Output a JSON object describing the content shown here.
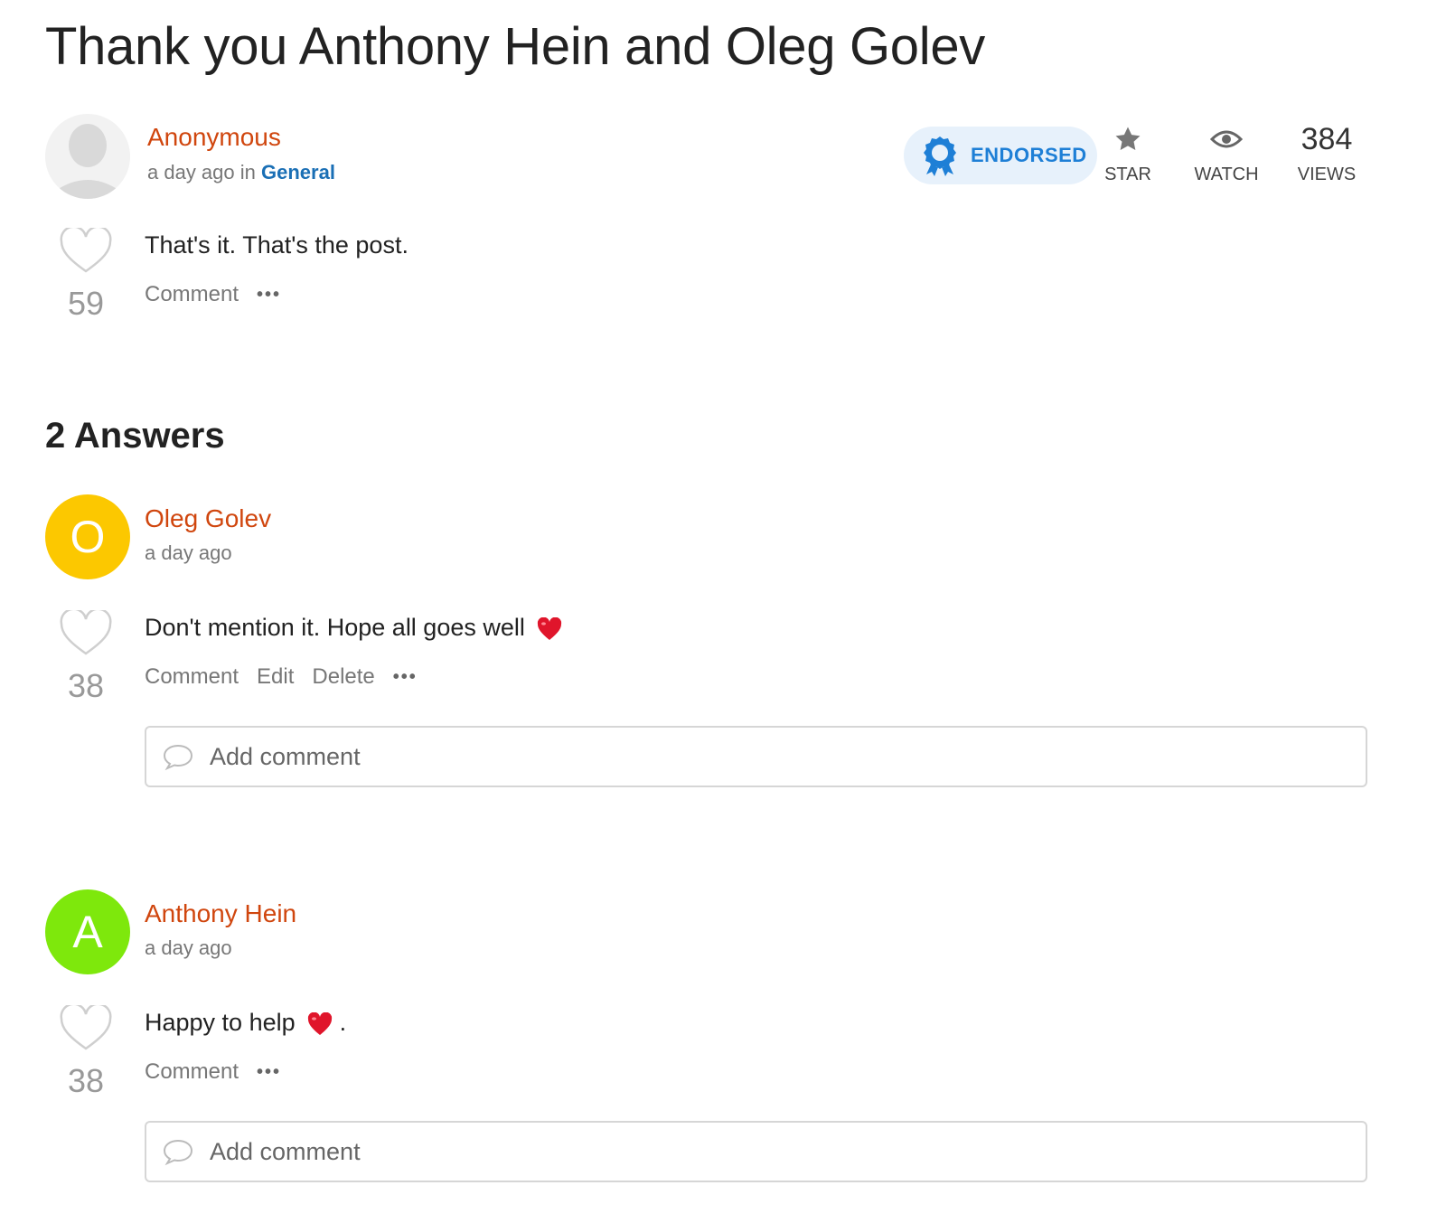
{
  "title": "Thank you Anthony Hein and Oleg Golev",
  "post": {
    "author": "Anonymous",
    "time": "a day ago",
    "in_word": "in",
    "category": "General",
    "endorsed_label": "ENDORSED",
    "star_label": "STAR",
    "watch_label": "WATCH",
    "views_count": "384",
    "views_label": "VIEWS",
    "body": "That's it. That's the post.",
    "likes": "59",
    "comment_label": "Comment",
    "more_label": "•••"
  },
  "answers_heading": "2 Answers",
  "answers": [
    {
      "avatar_letter": "O",
      "avatar_color": "#fcc800",
      "author": "Oleg Golev",
      "time": "a day ago",
      "body": "Don't mention it. Hope all goes well",
      "likes": "38",
      "comment_label": "Comment",
      "edit_label": "Edit",
      "delete_label": "Delete",
      "more_label": "•••",
      "add_comment_placeholder": "Add comment"
    },
    {
      "avatar_letter": "A",
      "avatar_color": "#7ee80c",
      "author": "Anthony Hein",
      "time": "a day ago",
      "body": "Happy to help",
      "body_suffix": ".",
      "likes": "38",
      "comment_label": "Comment",
      "more_label": "•••",
      "add_comment_placeholder": "Add comment"
    }
  ],
  "colors": {
    "author": "#d0460e",
    "category": "#1a6fb5",
    "endorsed_bg": "#e7f1fb",
    "endorsed_fg": "#1e7fd6",
    "heart_emoji": "#e0152b"
  },
  "icons": [
    "heart-outline-icon",
    "star-icon",
    "eye-icon",
    "award-ribbon-icon",
    "speech-bubble-icon",
    "heart-emoji-icon"
  ]
}
